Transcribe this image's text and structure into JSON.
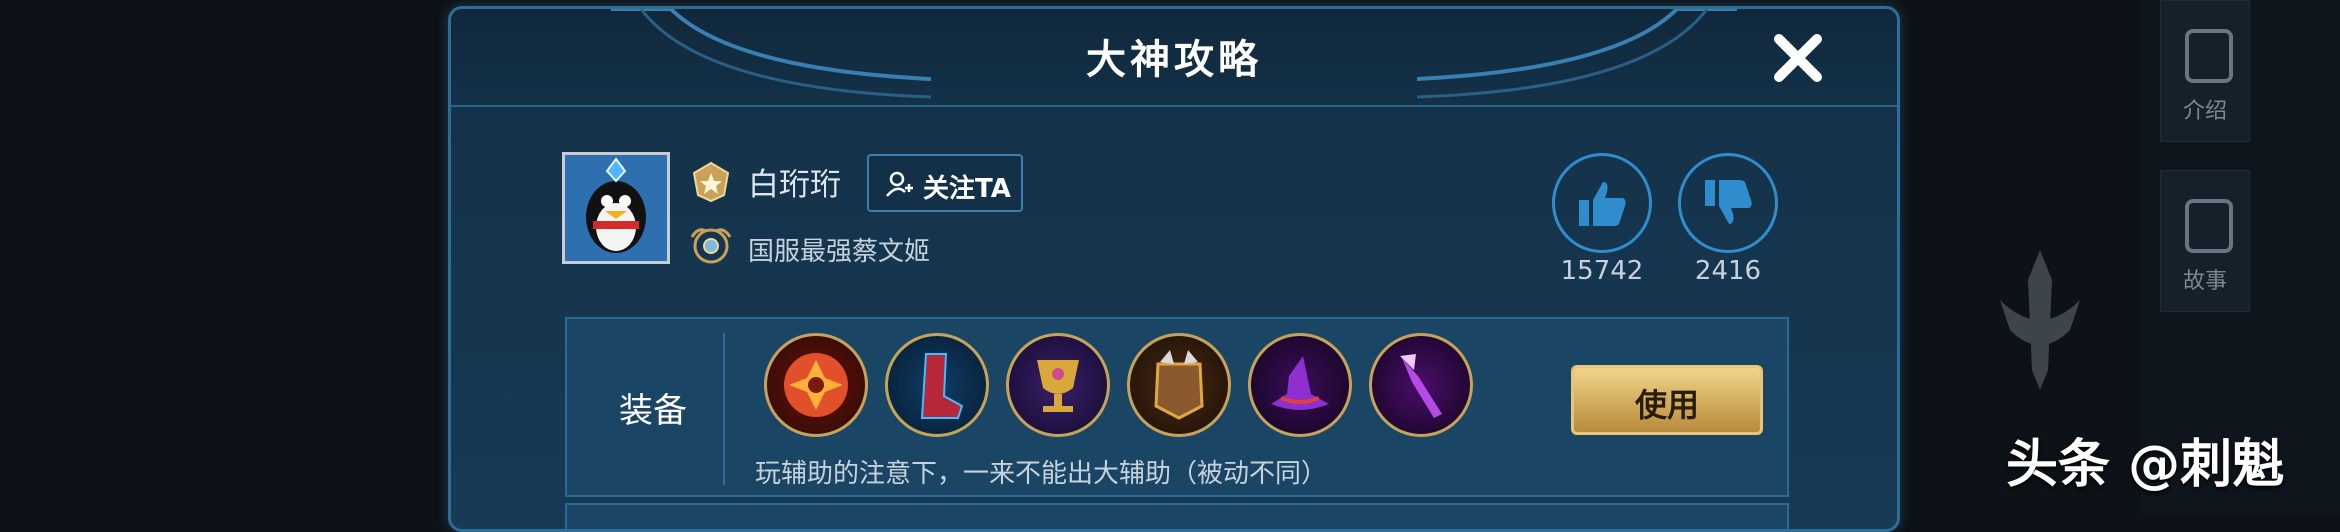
{
  "dialog": {
    "title": "大神攻略",
    "close_icon": "close-icon"
  },
  "profile": {
    "username": "白珩珩",
    "follow_label": "关注TA",
    "user_title": "国服最强蔡文姬"
  },
  "votes": {
    "likes": "15742",
    "dislikes": "2416"
  },
  "equipment": {
    "label": "装备",
    "items": [
      {
        "icon": "item-orange-sigil-icon",
        "color": "#e0502a"
      },
      {
        "icon": "item-red-boots-icon",
        "color": "#b8263a"
      },
      {
        "icon": "item-gold-chalice-icon",
        "color": "#d8a83a"
      },
      {
        "icon": "item-armor-icon",
        "color": "#8a5a2e"
      },
      {
        "icon": "item-purple-hat-icon",
        "color": "#8e2fd0"
      },
      {
        "icon": "item-purple-scepter-icon",
        "color": "#b64ae6"
      }
    ],
    "note": "玩辅助的注意下，一来不能出大辅助（被动不同）",
    "use_label": "使用"
  },
  "side_panel": {
    "tabs": [
      "介绍",
      "故事"
    ]
  },
  "watermark": "头条 @刺魁",
  "colors": {
    "accent_blue": "#2f8dcd",
    "gold": "#e7c47a"
  }
}
